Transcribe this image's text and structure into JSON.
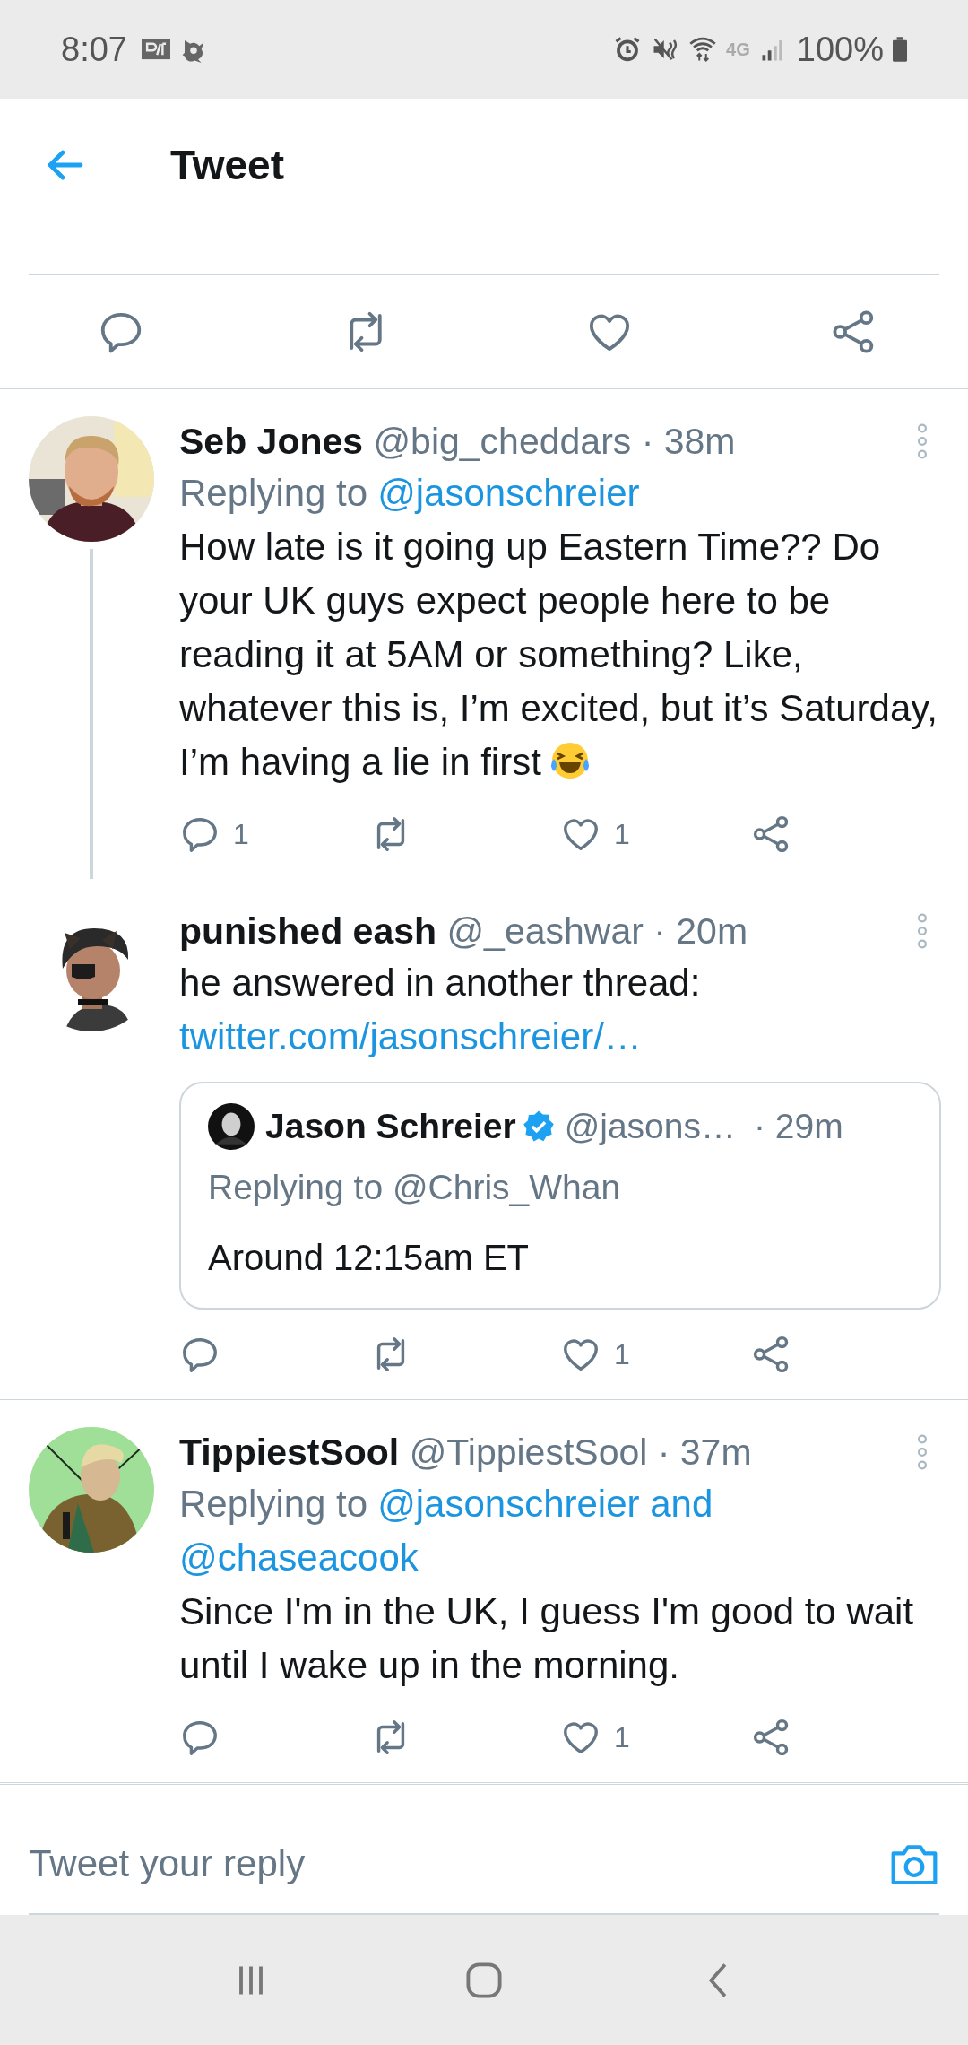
{
  "status_bar": {
    "time": "8:07",
    "network": "4G",
    "battery": "100%"
  },
  "header": {
    "title": "Tweet"
  },
  "replies": [
    {
      "kind": "plain",
      "name": "Seb Jones",
      "handle": "@big_cheddars",
      "time": "· 38m",
      "replying_prefix": "Replying to",
      "mentions": [
        "@jasonschreier"
      ],
      "text": "How late is it going up Eastern Time?? Do your UK guys expect people here to be reading it at 5AM or something? Like, whatever this is, I’m excited, but it’s Saturday, I’m having a lie in first",
      "emoji": true,
      "thread_line": true,
      "reply_count": "1",
      "like_count": "1"
    },
    {
      "kind": "quote",
      "name": "punished eash",
      "handle": "@_eashwar",
      "time": "· 20m",
      "text": "he answered in another thread:",
      "link": "twitter.com/jasonschreier/…",
      "quote": {
        "name": "Jason Schreier",
        "verified": true,
        "handle": "@jasons…",
        "time": "· 29m",
        "replying": "Replying to @Chris_Whan",
        "text": "Around 12:15am ET"
      },
      "like_count": "1"
    },
    {
      "kind": "plain",
      "name": "TippiestSool",
      "handle": "@TippiestSool",
      "time": "· 37m",
      "replying_prefix": "Replying to",
      "mentions": [
        "@jasonschreier and",
        "@chaseacook"
      ],
      "text": "Since I'm in the UK, I guess I'm good to wait until I wake up in the morning.",
      "like_count": "1"
    }
  ],
  "reply_bar": {
    "placeholder": "Tweet your reply"
  }
}
